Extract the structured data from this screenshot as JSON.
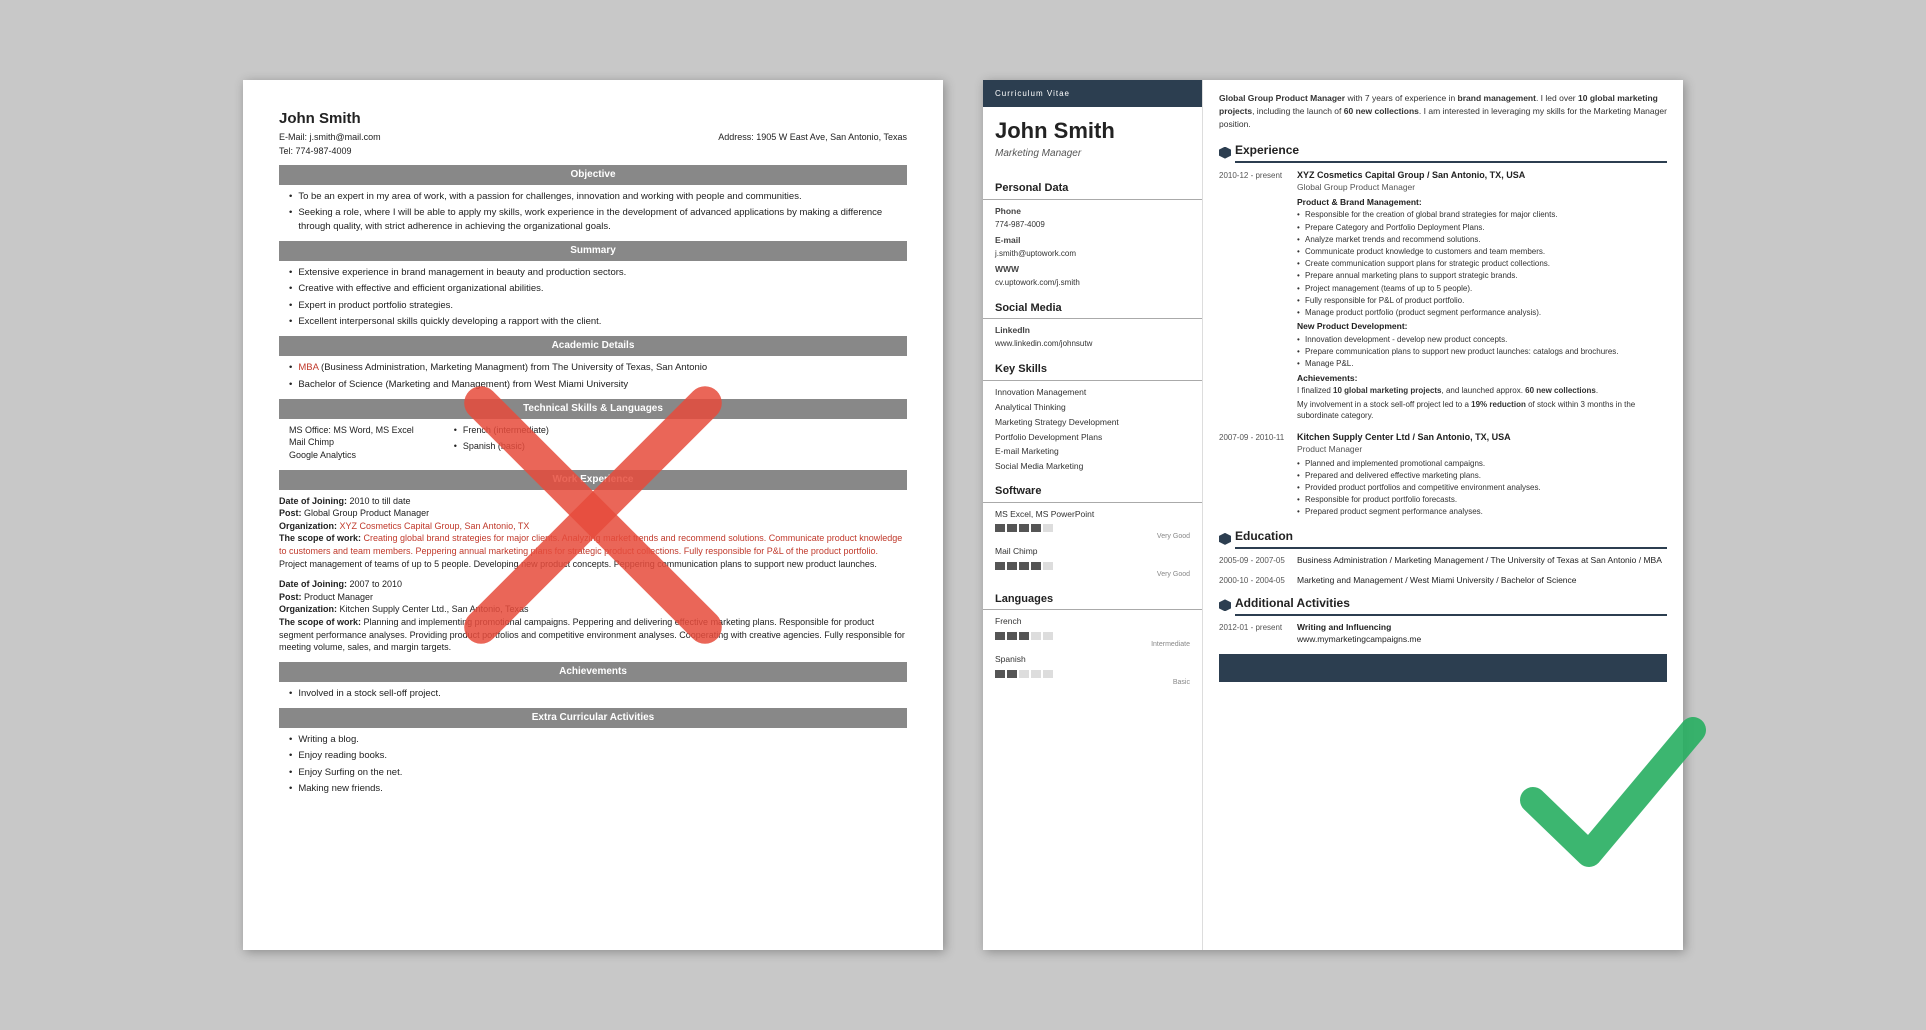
{
  "left_resume": {
    "name": "John Smith",
    "email": "E-Mail: j.smith@mail.com",
    "address": "Address: 1905 W East Ave, San Antonio, Texas",
    "tel": "Tel: 774-987-4009",
    "sections": {
      "objective": {
        "title": "Objective",
        "bullets": [
          "To be an expert in my area of work, with a passion for challenges, innovation and working with people and communities.",
          "Seeking a role, where I will be able to apply my skills, work experience in the development of advanced applications by making a difference through quality, with strict adherence in achieving the organizational goals."
        ]
      },
      "summary": {
        "title": "Summary",
        "bullets": [
          "Extensive experience in brand management in beauty and production sectors.",
          "Creative with effective and efficient organizational abilities.",
          "Expert in product portfolio strategies.",
          "Excellent interpersonal skills quickly developing a rapport with the client."
        ]
      },
      "academic": {
        "title": "Academic Details",
        "bullets": [
          "MBA (Business Administration, Marketing Managment) from The University of Texas, San Antonio",
          "Bachelor of Science (Marketing and Management) from West Miami University"
        ]
      },
      "technical": {
        "title": "Technical Skills & Languages",
        "col1": [
          "MS Office: MS Word, MS Excel",
          "Mail Chimp",
          "Google Analytics"
        ],
        "col2": [
          "French (intermediate)",
          "Spanish (basic)"
        ]
      },
      "work": {
        "title": "Work Experience",
        "entries": [
          {
            "date_of_joining": "Date of Joining: 2010 to till date",
            "post": "Post: Global Group Product Manager",
            "organization": "Organization: XYZ Cosmetics Capital Group, San Antonio, TX",
            "scope": "The scope of work: Creating global brand strategies for major clients. Analyzing market trends and recommend solutions. Communicate product knowledge to customers and team members. Peppering annual marketing plans for strategic product collections. Fully responsible for P&L of the product portfolio. Project management of teams of up to 5 people. Developing new product concepts. Peppering communication plans to support new product launches."
          },
          {
            "date_of_joining": "Date of Joining: 2007 to 2010",
            "post": "Post: Product Manager",
            "organization": "Organization: Kitchen Supply Center Ltd., San Antonio, Texas",
            "scope": "The scope of work: Planning and implementing promotional campaigns. Peppering and delivering effective marketing plans. Responsible for product segment performance analyses. Providing product portfolios and competitive environment analyses. Cooperating with creative agencies. Fully responsible for meeting volume, sales, and margin targets."
          }
        ]
      },
      "achievements": {
        "title": "Achievements",
        "bullets": [
          "Involved in a stock sell-off project."
        ]
      },
      "extra": {
        "title": "Extra Curricular Activities",
        "bullets": [
          "Writing a blog.",
          "Enjoy reading books.",
          "Enjoy Surfing on the net.",
          "Making new friends."
        ]
      }
    }
  },
  "right_resume": {
    "cv_label": "Curriculum Vitae",
    "name": "John Smith",
    "title": "Marketing Manager",
    "summary": "Global Group Product Manager with 7 years of experience in brand management. I led over 10 global marketing projects, including the launch of 60 new collections. I am interested in leveraging my skills for the Marketing Manager position.",
    "personal_data": {
      "section_title": "Personal Data",
      "phone_label": "Phone",
      "phone": "774-987-4009",
      "email_label": "E-mail",
      "email": "j.smith@uptowork.com",
      "www_label": "WWW",
      "www": "cv.uptowork.com/j.smith"
    },
    "social_media": {
      "section_title": "Social Media",
      "linkedin_label": "LinkedIn",
      "linkedin": "www.linkedin.com/johnsutw"
    },
    "key_skills": {
      "section_title": "Key Skills",
      "items": [
        "Innovation Management",
        "Analytical Thinking",
        "Marketing Strategy Development",
        "Portfolio Development Plans",
        "E-mail Marketing",
        "Social Media Marketing"
      ]
    },
    "software": {
      "section_title": "Software",
      "items": [
        {
          "name": "MS Excel, MS PowerPoint",
          "level": 4,
          "max": 5,
          "label": "Very Good"
        },
        {
          "name": "Mail Chimp",
          "level": 4,
          "max": 5,
          "label": "Very Good"
        }
      ]
    },
    "languages": {
      "section_title": "Languages",
      "items": [
        {
          "name": "French",
          "level": 3,
          "max": 5,
          "label": "Intermediate"
        },
        {
          "name": "Spanish",
          "level": 2,
          "max": 5,
          "label": "Basic"
        }
      ]
    },
    "experience": {
      "section_title": "Experience",
      "entries": [
        {
          "dates": "2010-12 - present",
          "company": "XYZ Cosmetics Capital Group / San Antonio, TX, USA",
          "role": "Global Group Product Manager",
          "subsections": [
            {
              "title": "Product & Brand Management:",
              "bullets": [
                "Responsible for the creation of global brand strategies for major clients.",
                "Prepare Category and Portfolio Deployment Plans.",
                "Analyze market trends and recommend solutions.",
                "Communicate product knowledge to customers and team members.",
                "Create communication support plans for strategic product collections.",
                "Prepare annual marketing plans to support strategic brands.",
                "Project management (teams of up to 5 people).",
                "Fully responsible for P&L of product portfolio.",
                "Manage product portfolio (product segment performance analysis)."
              ]
            },
            {
              "title": "New Product Development:",
              "bullets": [
                "Innovation development - develop new product concepts.",
                "Prepare communication plans to support new product launches: catalogs and brochures.",
                "Manage P&L."
              ]
            },
            {
              "title": "Achievements:",
              "achievement_text": "I finalized 10 global marketing projects, and launched approx. 60 new collections.",
              "achievement_text2": "My involvement in a stock sell-off project led to a 19% reduction of stock within 3 months in the subordinate category."
            }
          ]
        },
        {
          "dates": "2007-09 - 2010-11",
          "company": "Kitchen Supply Center Ltd / San Antonio, TX, USA",
          "role": "Product Manager",
          "bullets": [
            "Planned and implemented promotional campaigns.",
            "Prepared and delivered effective marketing plans.",
            "Provided product portfolios and competitive environment analyses.",
            "Responsible for product portfolio forecasts.",
            "Prepared product segment performance analyses."
          ]
        }
      ]
    },
    "education": {
      "section_title": "Education",
      "entries": [
        {
          "dates": "2005-09 - 2007-05",
          "degree": "Business Administration / Marketing Management / The University of Texas at San Antonio / MBA"
        },
        {
          "dates": "2000-10 - 2004-05",
          "degree": "Marketing and Management / West Miami University / Bachelor of Science"
        }
      ]
    },
    "additional": {
      "section_title": "Additional Activities",
      "entries": [
        {
          "dates": "2012-01 - present",
          "title": "Writing and Influencing",
          "detail": "www.mymarketingcampaigns.me"
        }
      ]
    }
  }
}
